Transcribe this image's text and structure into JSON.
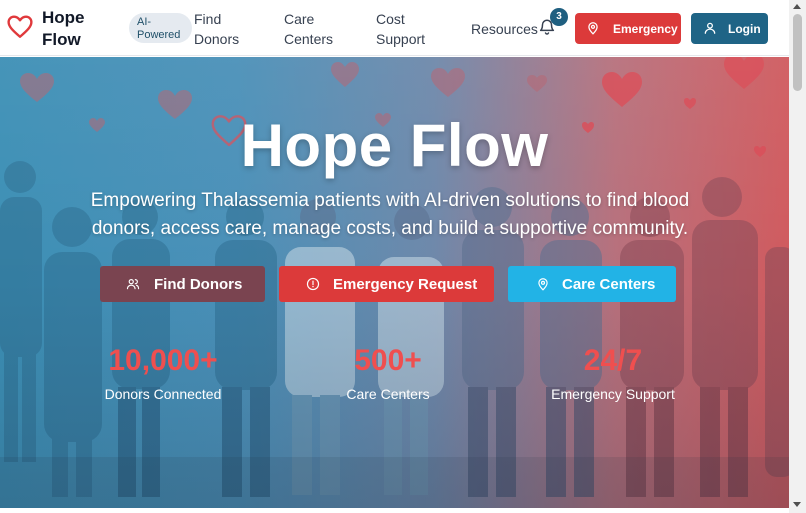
{
  "header": {
    "brand": "Hope Flow",
    "brand_line1": "Hope",
    "brand_line2": "Flow",
    "badge_line1": "AI-",
    "badge_line2": "Powered",
    "nav": [
      {
        "line1": "Find",
        "line2": "Donors"
      },
      {
        "line1": "Care",
        "line2": "Centers"
      },
      {
        "line1": "Cost",
        "line2": "Support"
      },
      {
        "line1": "Resources",
        "line2": ""
      }
    ],
    "notification_count": "3",
    "emergency_label": "Emergency",
    "login_label": "Login",
    "icons": {
      "logo": "heart-icon",
      "bell": "bell-icon",
      "emergency": "map-pin-icon",
      "login": "user-icon"
    }
  },
  "hero": {
    "title": "Hope Flow",
    "subtitle": "Empowering Thalassemia patients with AI-driven solutions to find blood donors, access care, manage costs, and build a supportive community.",
    "buttons": [
      {
        "label": "Find Donors",
        "icon": "users-icon"
      },
      {
        "label": "Emergency Request",
        "icon": "alert-circle-icon"
      },
      {
        "label": "Care Centers",
        "icon": "map-pin-icon"
      }
    ],
    "stats": [
      {
        "value": "10,000+",
        "label": "Donors Connected"
      },
      {
        "value": "500+",
        "label": "Care Centers"
      },
      {
        "value": "24/7",
        "label": "Emergency Support"
      }
    ]
  },
  "colors": {
    "accent_red": "#dc3a3a",
    "accent_blue": "#1f6486",
    "cyan": "#22b3e6",
    "stat_red": "#ef4f4f",
    "maroon": "#7a4450"
  }
}
